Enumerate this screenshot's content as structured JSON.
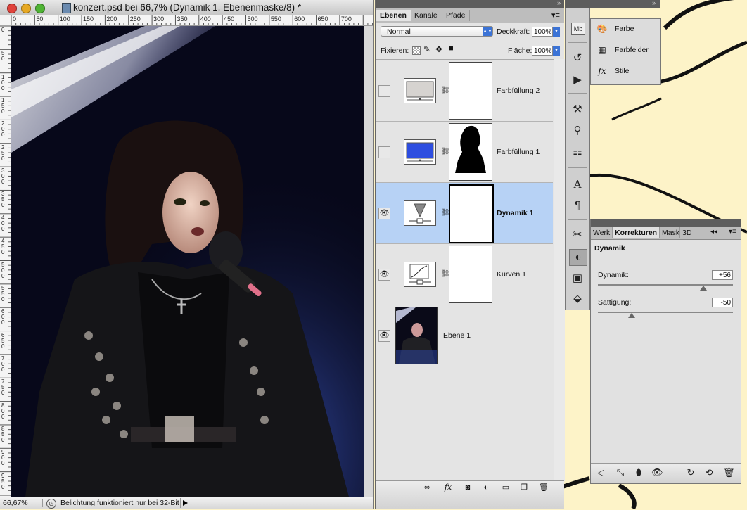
{
  "window": {
    "title": "konzert.psd bei 66,7% (Dynamik 1, Ebenenmaske/8) *",
    "zoom": "66,67%",
    "status_message": "Belichtung funktioniert nur bei 32-Bit"
  },
  "rulers": {
    "top_ticks": [
      "0",
      "50",
      "100",
      "150",
      "200",
      "250",
      "300",
      "350",
      "400",
      "450",
      "500",
      "550",
      "600",
      "650",
      "700"
    ],
    "left_ticks": [
      "0",
      "50",
      "100",
      "150",
      "200",
      "250",
      "300",
      "350",
      "400",
      "450",
      "500",
      "550",
      "600",
      "650",
      "700",
      "750",
      "800",
      "850",
      "900",
      "950"
    ]
  },
  "layers_panel": {
    "tabs": [
      "Ebenen",
      "Kanäle",
      "Pfade"
    ],
    "active_tab": "Ebenen",
    "blend_mode": "Normal",
    "opacity_label": "Deckkraft:",
    "opacity_value": "100%",
    "lock_label": "Fixieren:",
    "fill_label": "Fläche:",
    "fill_value": "100%",
    "layers": [
      {
        "name": "Farbfüllung 2",
        "visible": false,
        "selected": false,
        "kind": "fill-gray"
      },
      {
        "name": "Farbfüllung 1",
        "visible": false,
        "selected": false,
        "kind": "fill-blue"
      },
      {
        "name": "Dynamik 1",
        "visible": true,
        "selected": true,
        "kind": "vibrance"
      },
      {
        "name": "Kurven 1",
        "visible": true,
        "selected": false,
        "kind": "curves"
      },
      {
        "name": "Ebene 1",
        "visible": true,
        "selected": false,
        "kind": "photo"
      }
    ],
    "colors": {
      "selected_row": "#b7d2f5",
      "blue_fill": "#2e4ee0",
      "gray_fill": "#d6d3d0"
    }
  },
  "flyout": {
    "items": [
      {
        "label": "Farbe",
        "icon": "palette-icon"
      },
      {
        "label": "Farbfelder",
        "icon": "swatches-icon"
      },
      {
        "label": "Stile",
        "icon": "styles-icon"
      }
    ]
  },
  "corrections_panel": {
    "tabs": [
      "Werk",
      "Korrekturen",
      "Mask",
      "3D"
    ],
    "active_tab": "Korrekturen",
    "heading": "Dynamik",
    "sliders": [
      {
        "label": "Dynamik:",
        "value": "+56",
        "position": 0.78
      },
      {
        "label": "Sättigung:",
        "value": "-50",
        "position": 0.25
      }
    ]
  }
}
